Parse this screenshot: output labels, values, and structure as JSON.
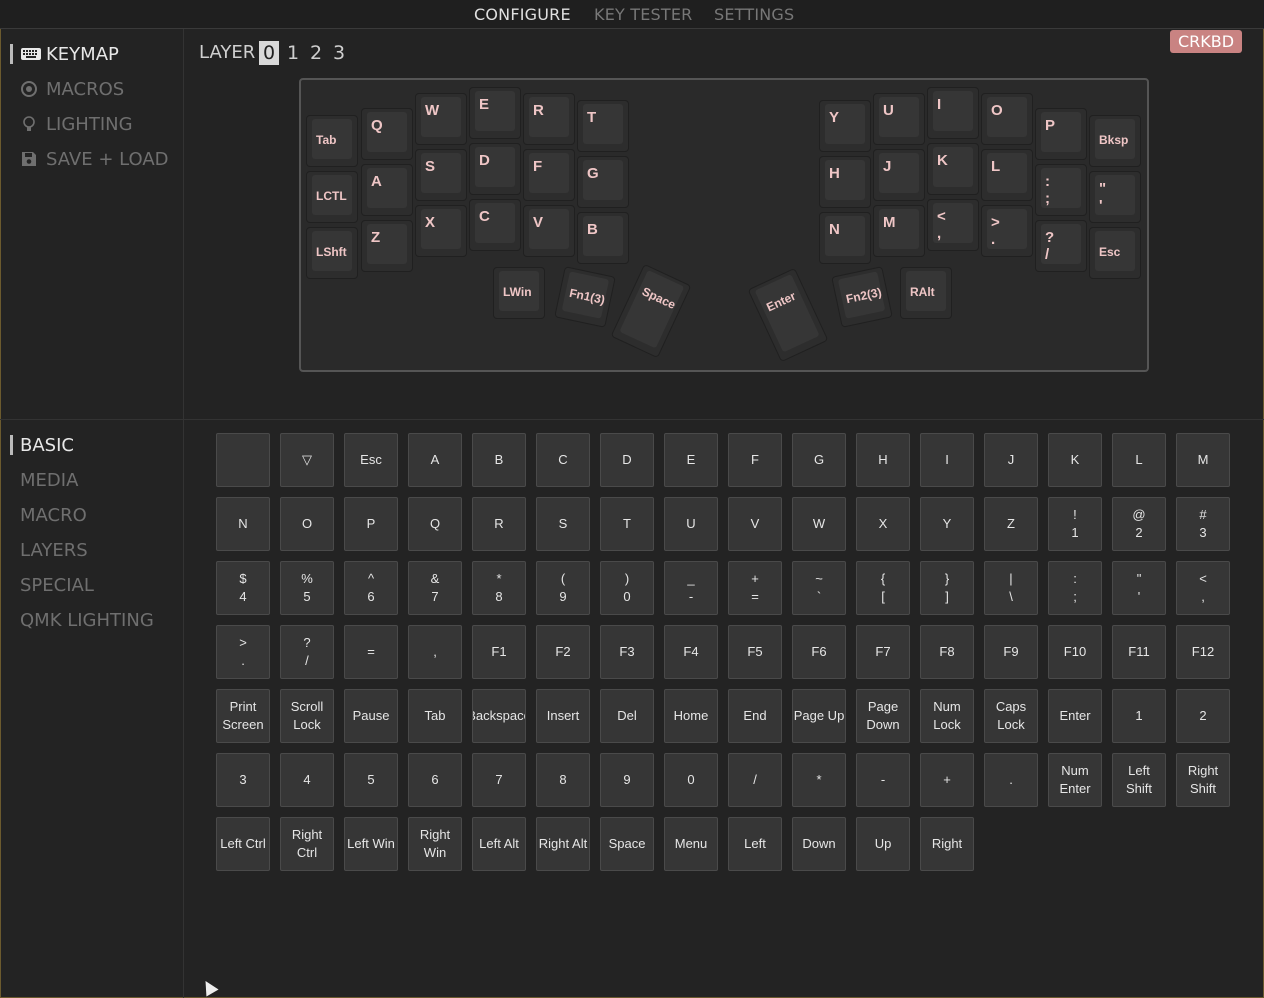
{
  "topnav": {
    "tabs": [
      {
        "label": "CONFIGURE",
        "active": true
      },
      {
        "label": "KEY TESTER",
        "active": false
      },
      {
        "label": "SETTINGS",
        "active": false
      }
    ]
  },
  "sidebar_top": {
    "items": [
      {
        "label": "KEYMAP",
        "icon": "keyboard-icon",
        "active": true
      },
      {
        "label": "MACROS",
        "icon": "circle-dot-icon",
        "active": false
      },
      {
        "label": "LIGHTING",
        "icon": "lightbulb-icon",
        "active": false
      },
      {
        "label": "SAVE + LOAD",
        "icon": "save-icon",
        "active": false
      }
    ]
  },
  "layer": {
    "label": "LAYER",
    "options": [
      "0",
      "1",
      "2",
      "3"
    ],
    "selected": "0"
  },
  "device_badge": "CRKBD",
  "keymap": {
    "left": [
      [
        "Tab",
        "Q",
        "W",
        "E",
        "R",
        "T"
      ],
      [
        "LCTL",
        "A",
        "S",
        "D",
        "F",
        "G"
      ],
      [
        "LShft",
        "Z",
        "X",
        "C",
        "V",
        "B"
      ]
    ],
    "right": [
      [
        "Y",
        "U",
        "I",
        "O",
        "P",
        "Bksp"
      ],
      [
        "H",
        "J",
        "K",
        "L",
        ":\n;",
        "\"\n'"
      ],
      [
        "N",
        "M",
        "<\n,",
        ">\n.",
        "?\n/",
        "Esc"
      ]
    ],
    "thumbs_left": [
      "LWin",
      "Fn1(3)",
      "Space"
    ],
    "thumbs_right": [
      "Enter",
      "Fn2(3)",
      "RAlt"
    ]
  },
  "sidebar_bottom": {
    "items": [
      {
        "label": "BASIC",
        "active": true
      },
      {
        "label": "MEDIA",
        "active": false
      },
      {
        "label": "MACRO",
        "active": false
      },
      {
        "label": "LAYERS",
        "active": false
      },
      {
        "label": "SPECIAL",
        "active": false
      },
      {
        "label": "QMK LIGHTING",
        "active": false
      }
    ]
  },
  "palette": [
    "",
    "▽",
    "Esc",
    "A",
    "B",
    "C",
    "D",
    "E",
    "F",
    "G",
    "H",
    "I",
    "J",
    "K",
    "L",
    "M",
    "N",
    "O",
    "P",
    "Q",
    "R",
    "S",
    "T",
    "U",
    "V",
    "W",
    "X",
    "Y",
    "Z",
    "!\n1",
    "@\n2",
    "#\n3",
    "$\n4",
    "%\n5",
    "^\n6",
    "&\n7",
    "*\n8",
    "(\n9",
    ")\n0",
    "_\n-",
    "+\n=",
    "~\n`",
    "{\n[",
    "}\n]",
    "|\n\\",
    ":\n;",
    "\"\n'",
    "<\n,",
    ">\n.",
    "?\n/",
    "=",
    ",",
    "F1",
    "F2",
    "F3",
    "F4",
    "F5",
    "F6",
    "F7",
    "F8",
    "F9",
    "F10",
    "F11",
    "F12",
    "Print\nScreen",
    "Scroll\nLock",
    "Pause",
    "Tab",
    "Backspace",
    "Insert",
    "Del",
    "Home",
    "End",
    "Page Up",
    "Page\nDown",
    "Num\nLock",
    "Caps\nLock",
    "Enter",
    "1",
    "2",
    "3",
    "4",
    "5",
    "6",
    "7",
    "8",
    "9",
    "0",
    "/",
    "*",
    "-",
    "+",
    ".",
    "Num\nEnter",
    "Left\nShift",
    "Right\nShift",
    "Left Ctrl",
    "Right\nCtrl",
    "Left Win",
    "Right\nWin",
    "Left Alt",
    "Right Alt",
    "Space",
    "Menu",
    "Left",
    "Down",
    "Up",
    "Right"
  ]
}
